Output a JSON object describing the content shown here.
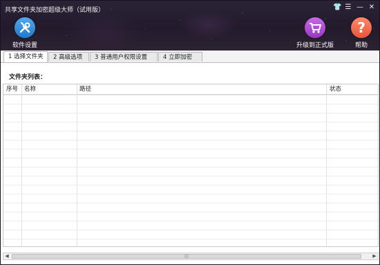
{
  "window": {
    "title": "共享文件夹加密超级大师（试用版）",
    "controls": {
      "skin": "👕",
      "menu": "☰",
      "minimize": "—",
      "close": "✕"
    }
  },
  "toolbar": {
    "settings_label": "软件设置",
    "upgrade_label": "升级到正式版",
    "help_label": "帮助",
    "help_glyph": "?"
  },
  "tabs": [
    {
      "label": "1 选择文件夹",
      "active": true
    },
    {
      "label": "2 高级选项",
      "active": false
    },
    {
      "label": "3 普通用户权限设置",
      "active": false
    },
    {
      "label": "4 立即加密",
      "active": false
    }
  ],
  "main": {
    "folder_list_label": "文件夹列表："
  },
  "table": {
    "columns": [
      "序号",
      "名称",
      "路径",
      "状态"
    ],
    "rows": []
  },
  "colors": {
    "settings_icon": "#2f8ee0",
    "upgrade_icon": "#b04fd6",
    "help_icon": "#f06a4a"
  }
}
